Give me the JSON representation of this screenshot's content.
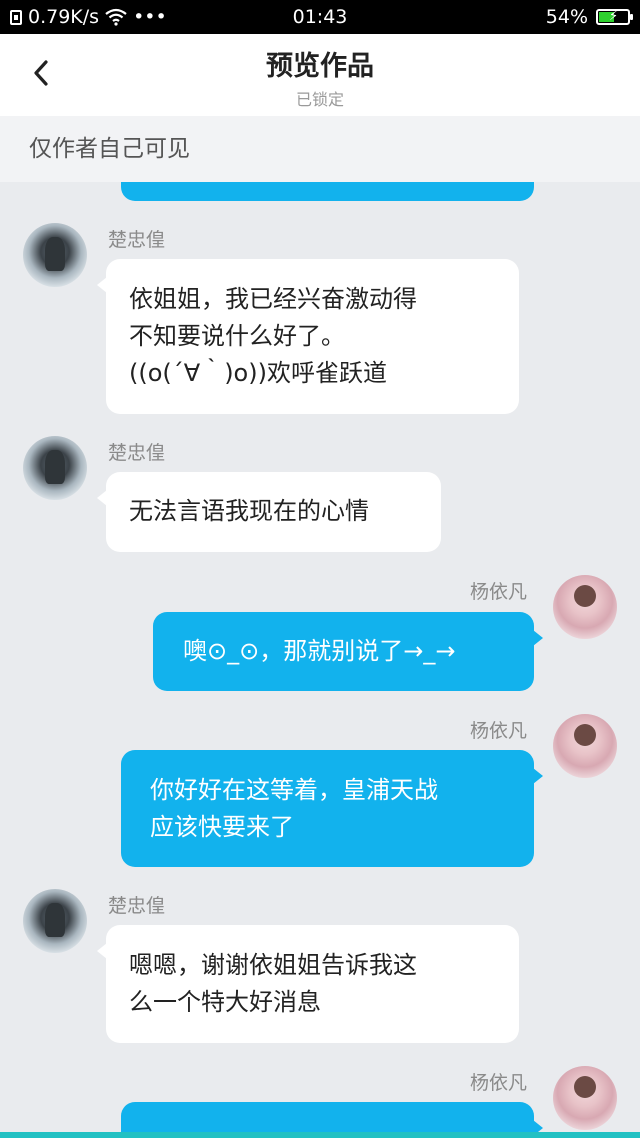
{
  "status_bar": {
    "speed": "0.79K/s",
    "dots": "•••",
    "time": "01:43",
    "battery": "54%",
    "battery_level": 0.54
  },
  "header": {
    "title": "预览作品",
    "subtitle": "已锁定"
  },
  "notice": "仅作者自己可见",
  "messages": [
    {
      "side": "out",
      "sender": "",
      "text": ""
    },
    {
      "side": "in",
      "sender": "楚忠偟",
      "text": "依姐姐，我已经兴奋激动得\n不知要说什么好了。\n((o(´∀｀)o))欢呼雀跃道"
    },
    {
      "side": "in",
      "sender": "楚忠偟",
      "text": "无法言语我现在的心情"
    },
    {
      "side": "out",
      "sender": "杨依凡",
      "text": "噢⊙_⊙，那就别说了→_→"
    },
    {
      "side": "out",
      "sender": "杨依凡",
      "text": "你好好在这等着，皇浦天战\n应该快要来了"
    },
    {
      "side": "in",
      "sender": "楚忠偟",
      "text": "嗯嗯，谢谢依姐姐告诉我这\n么一个特大好消息"
    },
    {
      "side": "out",
      "sender": "杨依凡",
      "text": ""
    }
  ]
}
